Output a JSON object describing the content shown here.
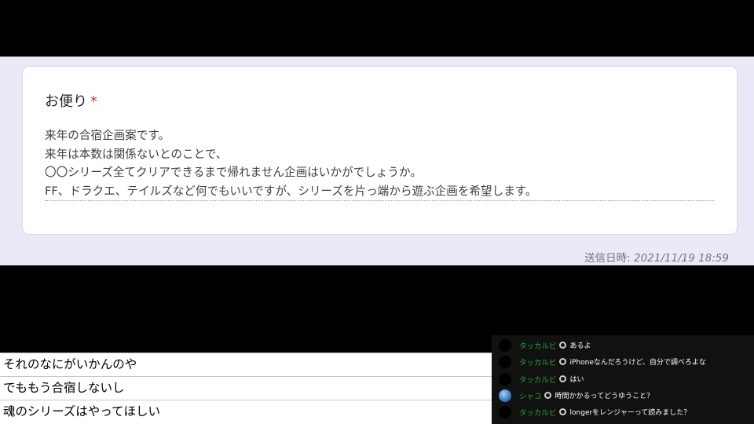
{
  "form": {
    "question_title": "お便り",
    "required_mark": "*",
    "answer_lines": [
      "来年の合宿企画案です。",
      "来年は本数は関係ないとのことで、",
      "〇〇シリーズ全てクリアできるまで帰れません企画はいかがでしょうか。",
      "FF、ドラクエ、テイルズなど何でもいいですが、シリーズを片っ端から遊ぶ企画を希望します。"
    ],
    "timestamp_label": "送信日時:",
    "timestamp_value": "2021/11/19 18:59"
  },
  "left_comments": [
    "それのなにがいかんのや",
    "でももう合宿しないし",
    "魂のシリーズはやってほしい"
  ],
  "chat": [
    {
      "name": "タッカルビ",
      "message": "あるよ",
      "avatar": "black"
    },
    {
      "name": "タッカルビ",
      "message": "iPhoneなんだろうけど、自分で調べろよな",
      "avatar": "black"
    },
    {
      "name": "タッカルビ",
      "message": "はい",
      "avatar": "black"
    },
    {
      "name": "シャコ",
      "message": "時間かかるってどうゆうこと？",
      "avatar": "earth"
    },
    {
      "name": "タッカルビ",
      "message": "longerをレンジャーって読みました？",
      "avatar": "black"
    }
  ],
  "colors": {
    "form_bg": "#ece8f7",
    "required": "#d93025",
    "chat_name": "#2ba640"
  }
}
